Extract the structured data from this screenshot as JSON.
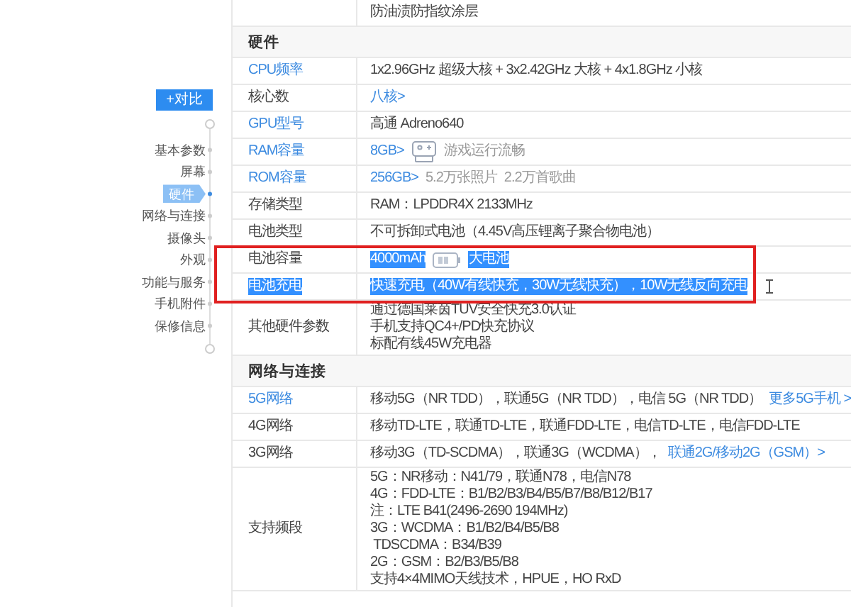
{
  "compare_button": "+对比",
  "nav": [
    {
      "label": "基本参数",
      "selected": false
    },
    {
      "label": "屏幕",
      "selected": false
    },
    {
      "label": "硬件",
      "selected": true
    },
    {
      "label": "网络与连接",
      "selected": false
    },
    {
      "label": "摄像头",
      "selected": false
    },
    {
      "label": "外观",
      "selected": false
    },
    {
      "label": "功能与服务",
      "selected": false
    },
    {
      "label": "手机附件",
      "selected": false
    },
    {
      "label": "保修信息",
      "selected": false
    }
  ],
  "sections": [
    {
      "rows": [
        {
          "lines": [
            [
              {
                "kind": "text",
                "text": "防油渍防指纹涂层",
                "selected": false
              }
            ]
          ]
        }
      ]
    },
    {
      "title": "硬件",
      "rows": [
        {
          "label": "CPU频率",
          "link": true,
          "selected": false,
          "outlined": false,
          "lines": [
            [
              {
                "kind": "text",
                "text": "1x2.96GHz 超级大核 + 3x2.42GHz 大核 + 4x1.8GHz 小核",
                "selected": false
              }
            ]
          ]
        },
        {
          "label": "核心数",
          "link": false,
          "selected": false,
          "outlined": false,
          "lines": [
            [
              {
                "kind": "link",
                "text": "八核>",
                "selected": false
              }
            ]
          ]
        },
        {
          "label": "GPU型号",
          "link": true,
          "selected": false,
          "outlined": false,
          "lines": [
            [
              {
                "kind": "text",
                "text": "高通 Adreno640",
                "selected": false
              }
            ]
          ]
        },
        {
          "label": "RAM容量",
          "link": true,
          "selected": false,
          "outlined": false,
          "lines": [
            [
              {
                "kind": "link",
                "text": "8GB>",
                "selected": false
              },
              {
                "kind": "gamepad"
              },
              {
                "kind": "muted",
                "text": "游戏运行流畅",
                "selected": false
              }
            ]
          ]
        },
        {
          "label": "ROM容量",
          "link": true,
          "selected": false,
          "outlined": false,
          "lines": [
            [
              {
                "kind": "link",
                "text": "256GB>",
                "selected": false
              },
              {
                "kind": "muted",
                "text": "5.2万张照片",
                "selected": false
              },
              {
                "kind": "muted",
                "text": "2.2万首歌曲",
                "selected": false
              }
            ]
          ]
        },
        {
          "label": "存储类型",
          "link": false,
          "selected": false,
          "outlined": false,
          "lines": [
            [
              {
                "kind": "text",
                "text": "RAM：LPDDR4X 2133MHz",
                "selected": false
              }
            ]
          ]
        },
        {
          "label": "电池类型",
          "link": false,
          "selected": false,
          "outlined": false,
          "lines": [
            [
              {
                "kind": "text",
                "text": "不可拆卸式电池（4.45V高压锂离子聚合物电池）",
                "selected": false
              }
            ]
          ]
        },
        {
          "label": "电池容量",
          "link": false,
          "selected": false,
          "outlined": true,
          "lines": [
            [
              {
                "kind": "text",
                "text": "4000mAh",
                "selected": true
              },
              {
                "kind": "battery"
              },
              {
                "kind": "text",
                "text": "大电池",
                "selected": true
              }
            ]
          ]
        },
        {
          "label": "电池充电",
          "link": true,
          "selected": true,
          "outlined": true,
          "lines": [
            [
              {
                "kind": "text",
                "text": "快速充电（40W有线快充，30W无线快充），10W无线反向充电",
                "selected": true
              }
            ]
          ]
        },
        {
          "label": "其他硬件参数",
          "link": false,
          "selected": false,
          "outlined": false,
          "lines": [
            [
              {
                "kind": "text",
                "text": "通过德国莱茵TÜV安全快充3.0认证",
                "selected": false
              }
            ],
            [
              {
                "kind": "text",
                "text": "手机支持QC4+/PD快充协议",
                "selected": false
              }
            ],
            [
              {
                "kind": "text",
                "text": "标配有线45W充电器",
                "selected": false
              }
            ]
          ]
        }
      ]
    },
    {
      "title": "网络与连接",
      "rows": [
        {
          "label": "5G网络",
          "link": true,
          "selected": false,
          "outlined": false,
          "lines": [
            [
              {
                "kind": "text",
                "text": "移动5G（NR TDD），联通5G（NR TDD），电信 5G（NR TDD）",
                "selected": false
              },
              {
                "kind": "link",
                "text": "更多5G手机 >",
                "selected": false
              }
            ]
          ]
        },
        {
          "label": "4G网络",
          "link": false,
          "selected": false,
          "outlined": false,
          "lines": [
            [
              {
                "kind": "text",
                "text": "移动TD-LTE，联通TD-LTE，联通FDD-LTE，电信TD-LTE，电信FDD-LTE",
                "selected": false
              }
            ]
          ]
        },
        {
          "label": "3G网络",
          "link": false,
          "selected": false,
          "outlined": false,
          "lines": [
            [
              {
                "kind": "text",
                "text": "移动3G（TD-SCDMA），联通3G（WCDMA），",
                "selected": false
              },
              {
                "kind": "link",
                "text": "联通2G/移动2G（GSM）>",
                "selected": false
              }
            ]
          ]
        },
        {
          "label": "支持频段",
          "link": false,
          "selected": false,
          "outlined": false,
          "lines": [
            [
              {
                "kind": "text",
                "text": "5G：NR移动：N41/79，联通N78，电信N78",
                "selected": false
              }
            ],
            [
              {
                "kind": "text",
                "text": "4G：FDD-LTE：B1/B2/B3/B4/B5/B7/B8/B12/B17",
                "selected": false
              }
            ],
            [
              {
                "kind": "text",
                "text": "注：LTE B41(2496-2690 194MHz)",
                "selected": false
              }
            ],
            [
              {
                "kind": "text",
                "text": "3G：WCDMA：B1/B2/B4/B5/B8",
                "selected": false
              }
            ],
            [
              {
                "kind": "text",
                "text": " TDSCDMA：B34/B39",
                "selected": false
              }
            ],
            [
              {
                "kind": "text",
                "text": "2G：GSM：B2/B3/B5/B8",
                "selected": false
              }
            ],
            [
              {
                "kind": "text",
                "text": "支持4×4MIMO天线技术，HPUE，HO RxD",
                "selected": false
              }
            ]
          ]
        }
      ]
    }
  ]
}
